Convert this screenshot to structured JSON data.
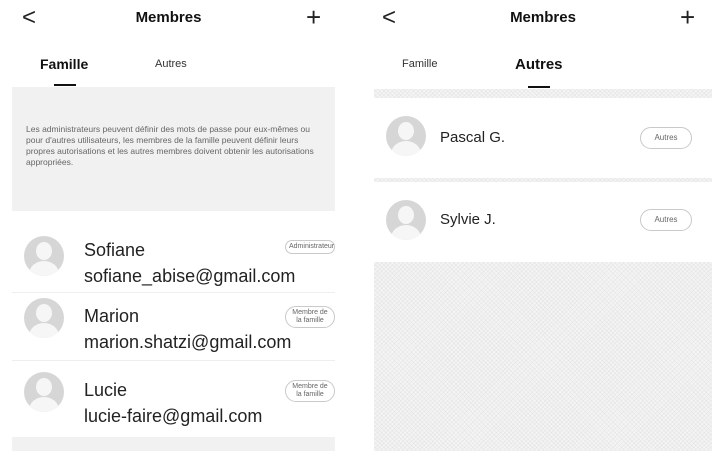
{
  "left_screen": {
    "header": {
      "back_icon": "chevron-left-icon",
      "back_glyph": "<",
      "title": "Membres",
      "add_glyph": "+"
    },
    "tabs": [
      {
        "label": "Famille",
        "active": true
      },
      {
        "label": "Autres",
        "active": false
      }
    ],
    "info_text": "Les administrateurs peuvent définir des mots de passe pour eux-mêmes ou pour d'autres utilisateurs, les membres de la famille peuvent définir leurs propres autorisations et les autres membres doivent obtenir les autorisations appropriées.",
    "members": [
      {
        "name": "Sofiane",
        "email": "sofiane_abise@gmail.com",
        "role": "Administrateur"
      },
      {
        "name": "Marion",
        "email": "marion.shatzi@gmail.com",
        "role": "Membre de la famille"
      },
      {
        "name": "Lucie",
        "email": "lucie-faire@gmail.com",
        "role": "Membre de la famille"
      }
    ]
  },
  "right_screen": {
    "header": {
      "back_icon": "chevron-left-icon",
      "back_glyph": "<",
      "title": "Membres",
      "add_glyph": "+"
    },
    "tabs": [
      {
        "label": "Famille",
        "active": false
      },
      {
        "label": "Autres",
        "active": true
      }
    ],
    "members": [
      {
        "name": "Pascal G.",
        "role": "Autres"
      },
      {
        "name": "Sylvie J.",
        "role": "Autres"
      }
    ]
  },
  "colors": {
    "background": "#ffffff",
    "panel": "#f1f1f1",
    "avatar": "#d6d6d6",
    "text": "#222222"
  }
}
